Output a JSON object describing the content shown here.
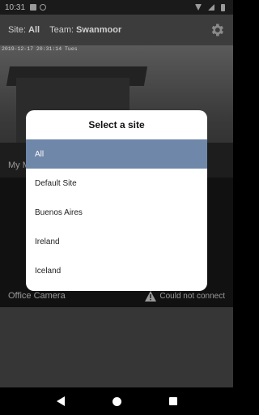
{
  "status_bar": {
    "time": "10:31"
  },
  "app_bar": {
    "site_label": "Site:",
    "site_value": "All",
    "team_label": "Team:",
    "team_value": "Swanmoor",
    "settings_icon": "gear-icon"
  },
  "cameras": [
    {
      "timestamp": "2019-12-17 20:31:14 Tues",
      "name": "My M"
    },
    {
      "name": "Office Camera",
      "status": "Could not connect",
      "status_icon": "warning-icon"
    }
  ],
  "dialog": {
    "title": "Select a site",
    "options": [
      "All",
      "Default Site",
      "Buenos Aires",
      "Ireland",
      "Iceland"
    ],
    "selected_index": 0,
    "selected_color": "#6f87a9"
  }
}
